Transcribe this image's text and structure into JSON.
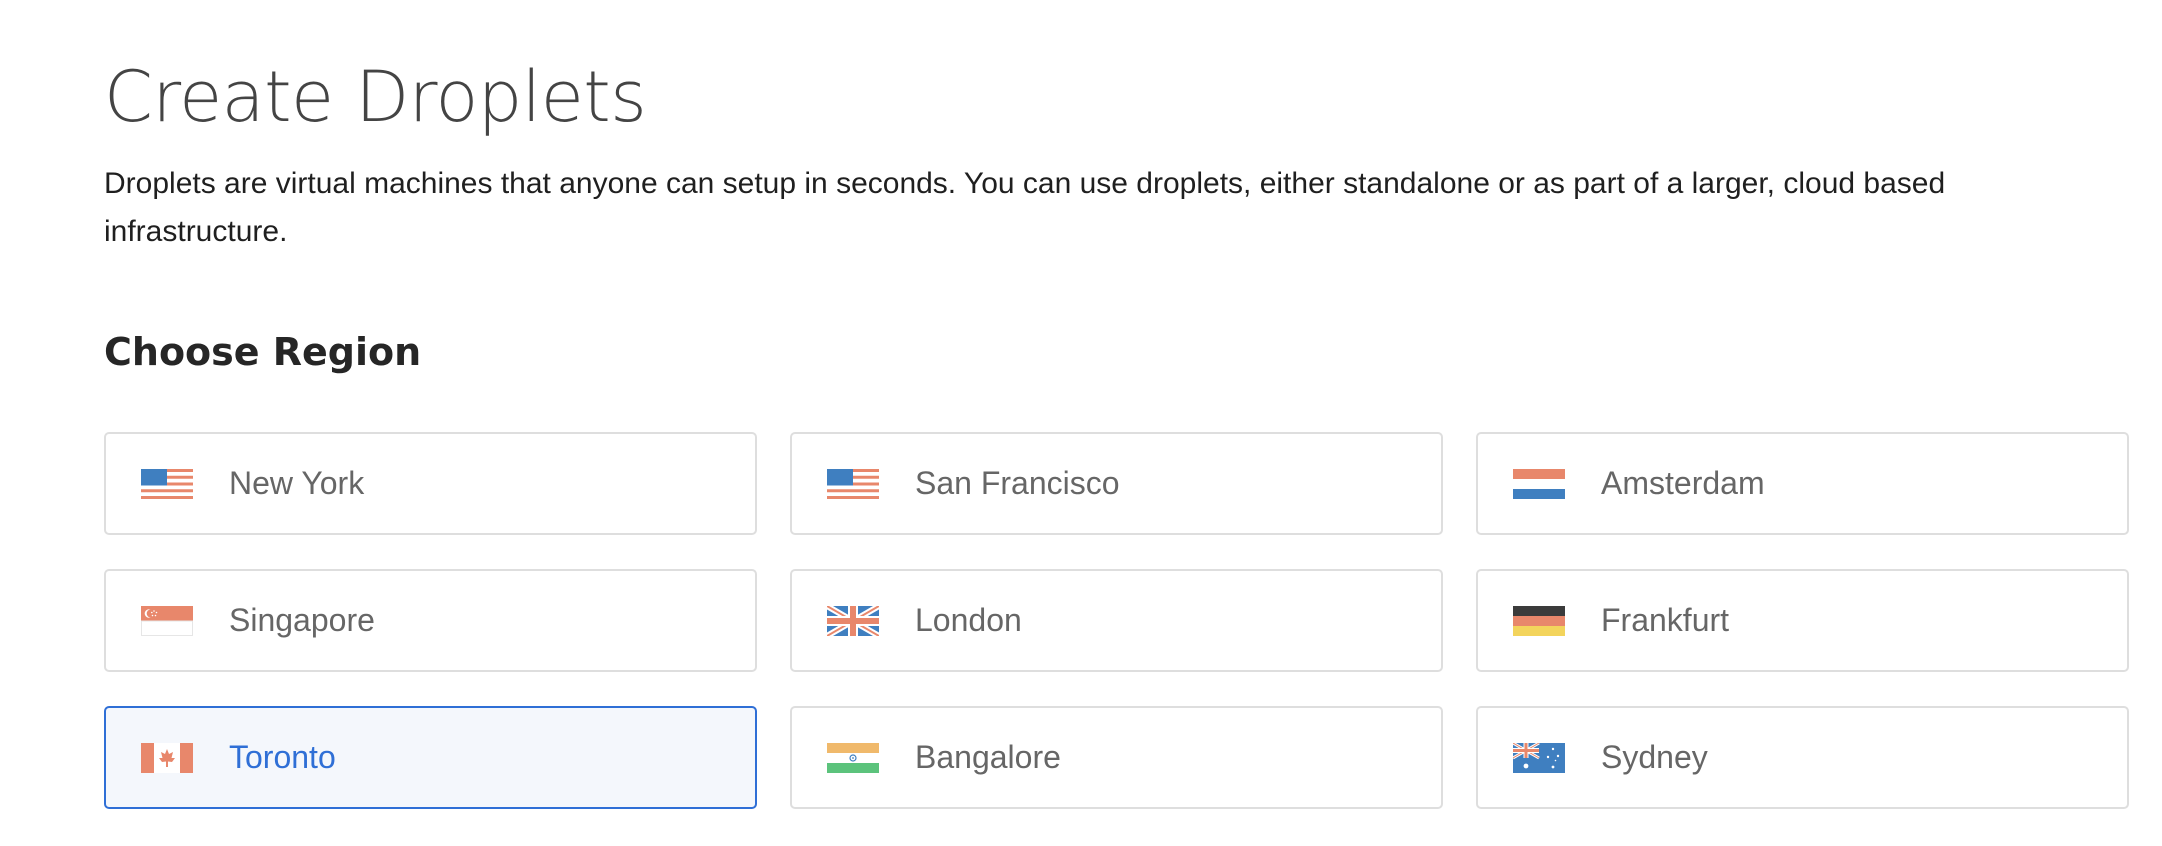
{
  "header": {
    "title": "Create Droplets",
    "description": "Droplets are virtual machines that anyone can setup in seconds. You can use droplets, either standalone or as part of a larger, cloud based infrastructure."
  },
  "region_section": {
    "title": "Choose Region",
    "selected": "Toronto",
    "regions": [
      {
        "label": "New York",
        "flag": "us-flag-icon"
      },
      {
        "label": "San Francisco",
        "flag": "us-flag-icon"
      },
      {
        "label": "Amsterdam",
        "flag": "netherlands-flag-icon"
      },
      {
        "label": "Singapore",
        "flag": "singapore-flag-icon"
      },
      {
        "label": "London",
        "flag": "uk-flag-icon"
      },
      {
        "label": "Frankfurt",
        "flag": "germany-flag-icon"
      },
      {
        "label": "Toronto",
        "flag": "canada-flag-icon"
      },
      {
        "label": "Bangalore",
        "flag": "india-flag-icon"
      },
      {
        "label": "Sydney",
        "flag": "australia-flag-icon"
      }
    ]
  },
  "colors": {
    "accent": "#2f6fd6",
    "selected_bg": "#f4f7fc",
    "card_border": "#dedede",
    "flag_red": "#e8876b",
    "flag_blue": "#3f7fc0",
    "flag_yellow": "#f3d45c",
    "flag_dark": "#3b3b3b",
    "flag_green": "#5cc37c",
    "flag_saffron": "#f0b96b"
  }
}
